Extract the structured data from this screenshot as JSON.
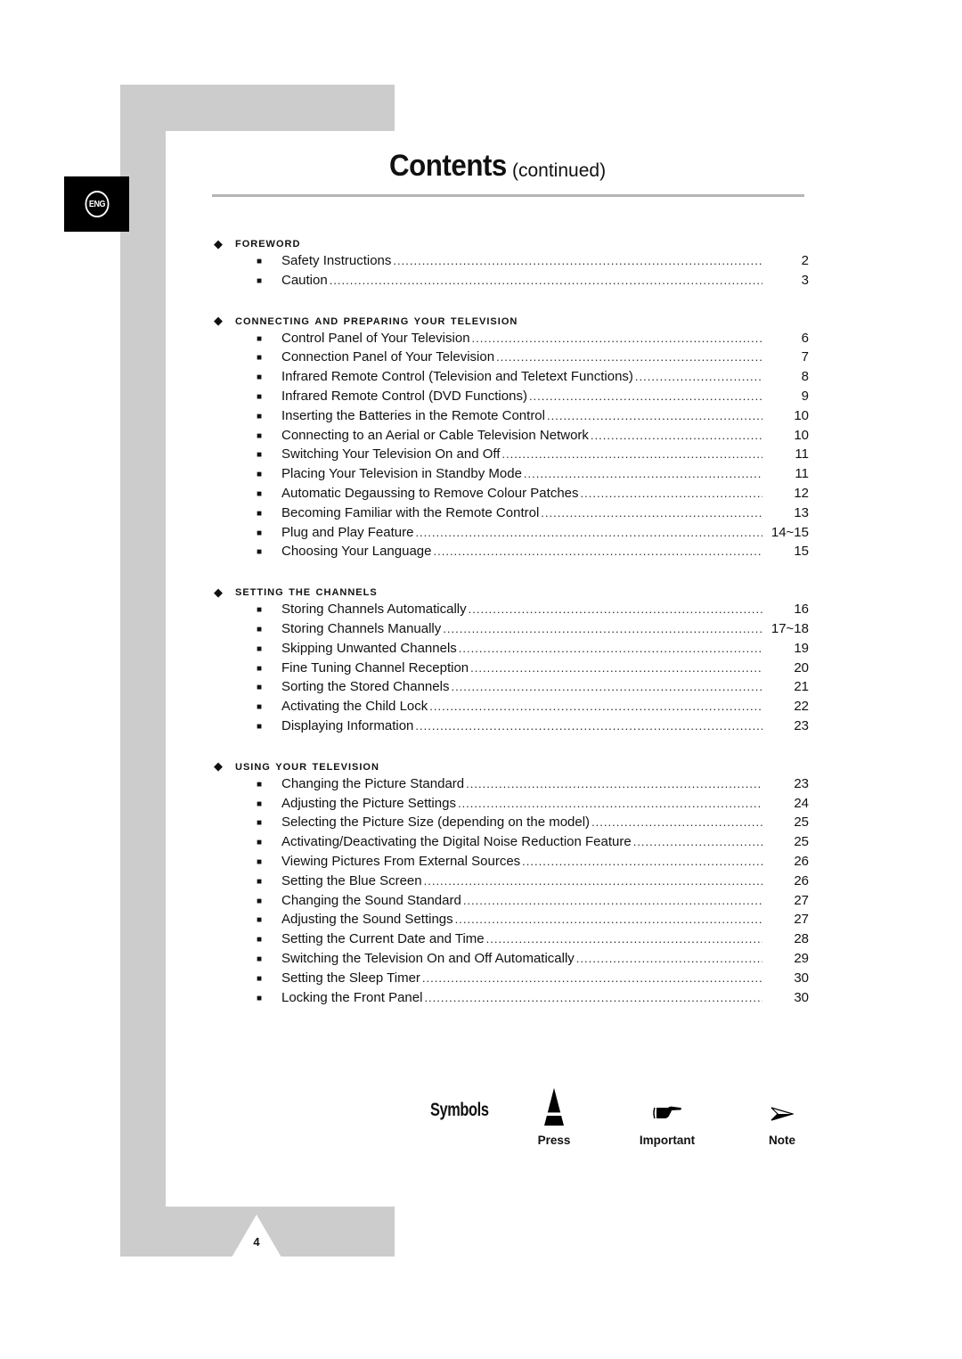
{
  "badge": {
    "language": "ENG"
  },
  "header": {
    "title": "Contents",
    "subtitle": "(continued)"
  },
  "icons": {
    "section_marker": "diamond-icon",
    "entry_marker": "square-bullet-icon"
  },
  "sections": [
    {
      "title": "Foreword",
      "entries": [
        {
          "label": "Safety Instructions",
          "page": "2"
        },
        {
          "label": "Caution",
          "page": "3"
        }
      ]
    },
    {
      "title": "Connecting and Preparing Your Television",
      "entries": [
        {
          "label": "Control Panel of Your Television",
          "page": "6"
        },
        {
          "label": "Connection Panel of Your Television",
          "page": "7"
        },
        {
          "label": "Infrared Remote Control (Television and Teletext Functions)",
          "page": "8"
        },
        {
          "label": "Infrared Remote Control (DVD Functions)",
          "page": "9"
        },
        {
          "label": "Inserting the Batteries in the Remote Control",
          "page": "10"
        },
        {
          "label": "Connecting to an Aerial or Cable Television Network",
          "page": "10"
        },
        {
          "label": "Switching Your Television On and Off",
          "page": "11"
        },
        {
          "label": "Placing Your Television in Standby Mode",
          "page": "11"
        },
        {
          "label": "Automatic Degaussing to Remove Colour Patches",
          "page": "12"
        },
        {
          "label": "Becoming Familiar with the Remote Control",
          "page": "13"
        },
        {
          "label": "Plug and Play Feature",
          "page": "14~15"
        },
        {
          "label": "Choosing Your Language",
          "page": "15"
        }
      ]
    },
    {
      "title": "Setting the Channels",
      "entries": [
        {
          "label": "Storing Channels Automatically",
          "page": "16"
        },
        {
          "label": "Storing Channels Manually",
          "page": "17~18"
        },
        {
          "label": "Skipping Unwanted Channels",
          "page": "19"
        },
        {
          "label": "Fine Tuning Channel Reception",
          "page": "20"
        },
        {
          "label": "Sorting the Stored Channels",
          "page": "21"
        },
        {
          "label": "Activating the Child Lock",
          "page": "22"
        },
        {
          "label": "Displaying Information",
          "page": "23"
        }
      ]
    },
    {
      "title": "Using Your Television",
      "entries": [
        {
          "label": "Changing the Picture Standard",
          "page": "23"
        },
        {
          "label": "Adjusting the Picture Settings",
          "page": "24"
        },
        {
          "label": "Selecting the Picture Size (depending on the model)",
          "page": "25"
        },
        {
          "label": "Activating/Deactivating the Digital Noise Reduction Feature",
          "page": "25"
        },
        {
          "label": "Viewing Pictures From External Sources",
          "page": "26"
        },
        {
          "label": "Setting the Blue Screen",
          "page": "26"
        },
        {
          "label": "Changing the Sound Standard",
          "page": "27"
        },
        {
          "label": "Adjusting the Sound Settings",
          "page": "27"
        },
        {
          "label": "Setting the Current Date and Time",
          "page": "28"
        },
        {
          "label": "Switching the Television On and Off Automatically",
          "page": "29"
        },
        {
          "label": "Setting the Sleep Timer",
          "page": "30"
        },
        {
          "label": "Locking the Front Panel",
          "page": "30"
        }
      ]
    }
  ],
  "symbols": {
    "label": "Symbols",
    "items": [
      {
        "icon": "press-icon",
        "label": "Press"
      },
      {
        "icon": "pointing-hand-icon",
        "label": "Important"
      },
      {
        "icon": "arrowhead-icon",
        "label": "Note"
      }
    ]
  },
  "footer": {
    "page_number": "4"
  }
}
